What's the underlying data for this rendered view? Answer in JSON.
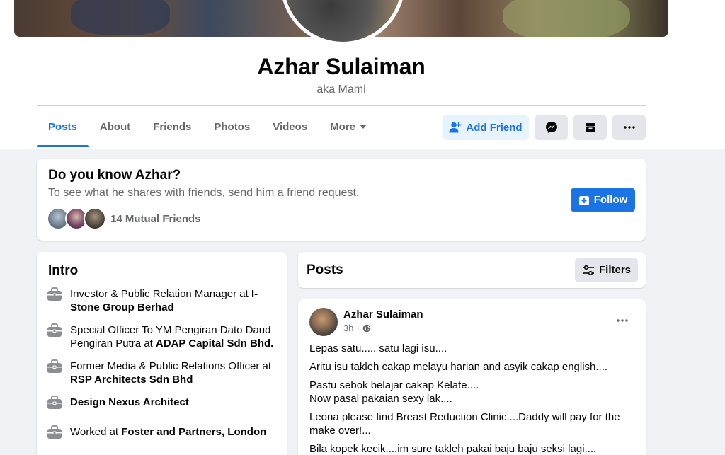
{
  "profile": {
    "name": "Azhar Sulaiman",
    "aka": "aka Mami"
  },
  "tabs": [
    {
      "label": "Posts",
      "active": true
    },
    {
      "label": "About"
    },
    {
      "label": "Friends"
    },
    {
      "label": "Photos"
    },
    {
      "label": "Videos"
    },
    {
      "label": "More"
    }
  ],
  "actions": {
    "add_friend": "Add Friend",
    "messenger_icon": "messenger-icon",
    "archive_icon": "archive-icon",
    "more_icon": "more-dots-icon"
  },
  "know": {
    "title": "Do you know Azhar?",
    "subtitle": "To see what he shares with friends, send him a friend request.",
    "mutual": "14 Mutual Friends",
    "follow": "Follow"
  },
  "intro": {
    "title": "Intro",
    "items": [
      {
        "prefix": "Investor & Public Relation Manager at ",
        "bold": "I-Stone Group Berhad"
      },
      {
        "prefix": "Special Officer To YM Pengiran Dato Daud Pengiran Putra at ",
        "bold": "ADAP Capital Sdn Bhd."
      },
      {
        "prefix": "Former Media & Public Relations Officer at ",
        "bold": "RSP Architects Sdn Bhd"
      },
      {
        "prefix": "",
        "bold": "Design Nexus Architect"
      },
      {
        "prefix": "Worked at ",
        "bold": "Foster and Partners, London"
      }
    ]
  },
  "posts": {
    "title": "Posts",
    "filters": "Filters"
  },
  "post": {
    "author": "Azhar Sulaiman",
    "time": "3h",
    "lines": [
      "Lepas satu..... satu lagi isu....",
      "Aritu isu takleh cakap melayu harian and asyik cakap english....",
      "Pastu sebok belajar cakap Kelate....\nNow pasal pakaian sexy lak....",
      "Leona please find Breast Reduction Clinic....Daddy will pay for the make over!...",
      "Bila kopek kecik....im sure takleh pakai baju baju seksi lagi...."
    ]
  },
  "colors": {
    "accent": "#1b74e4",
    "accent_light": "#e7f3ff",
    "grey_button": "#e4e6eb",
    "secondary_text": "#65676b"
  }
}
